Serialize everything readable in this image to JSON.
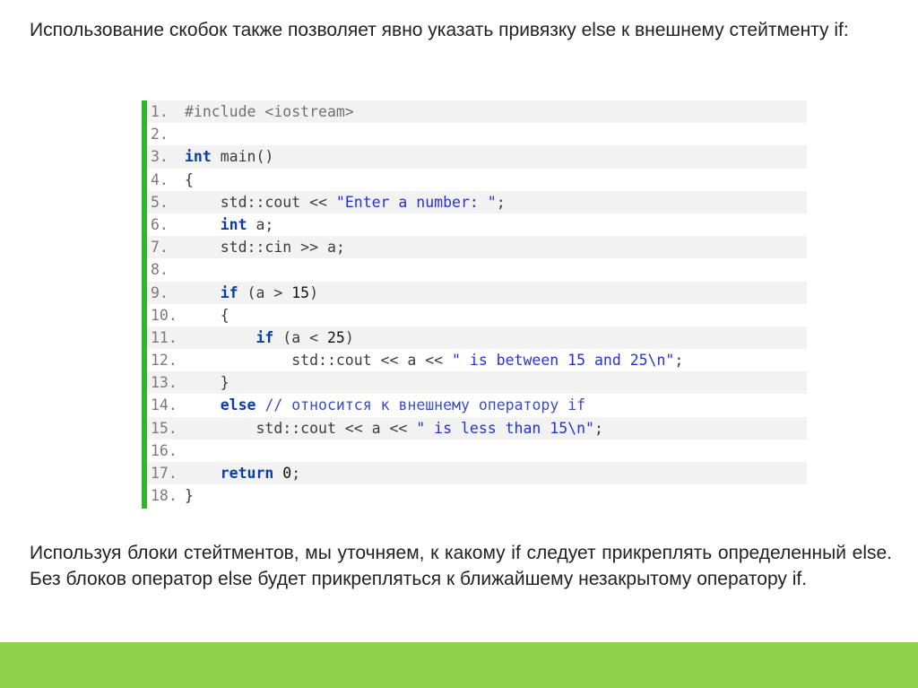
{
  "slide": {
    "intro_text": "Использование скобок также позволяет явно указать привязку else к внешнему стейтменту if:",
    "outro_text": "Используя блоки стейтментов, мы уточняем, к какому if следует прикреплять определенный else. Без блоков оператор else будет прикрепляться к ближайшему незакрытому оператору if."
  },
  "code": {
    "accent_color": "#2fb52f",
    "lines": [
      {
        "num": "1.",
        "parts": [
          {
            "t": "#include <iostream>",
            "c": "pp"
          }
        ]
      },
      {
        "num": "2.",
        "parts": []
      },
      {
        "num": "3.",
        "parts": [
          {
            "t": "int",
            "c": "kw"
          },
          {
            "t": " main()",
            "c": ""
          }
        ]
      },
      {
        "num": "4.",
        "parts": [
          {
            "t": "{",
            "c": ""
          }
        ]
      },
      {
        "num": "5.",
        "parts": [
          {
            "t": "    std::cout << ",
            "c": ""
          },
          {
            "t": "\"Enter a number: \"",
            "c": "str"
          },
          {
            "t": ";",
            "c": ""
          }
        ]
      },
      {
        "num": "6.",
        "parts": [
          {
            "t": "    ",
            "c": ""
          },
          {
            "t": "int",
            "c": "kw"
          },
          {
            "t": " a;",
            "c": ""
          }
        ]
      },
      {
        "num": "7.",
        "parts": [
          {
            "t": "    std::cin >> a;",
            "c": ""
          }
        ]
      },
      {
        "num": "8.",
        "parts": []
      },
      {
        "num": "9.",
        "parts": [
          {
            "t": "    ",
            "c": ""
          },
          {
            "t": "if",
            "c": "kw"
          },
          {
            "t": " (a > ",
            "c": ""
          },
          {
            "t": "15",
            "c": "num"
          },
          {
            "t": ")",
            "c": ""
          }
        ]
      },
      {
        "num": "10.",
        "parts": [
          {
            "t": "    {",
            "c": ""
          }
        ]
      },
      {
        "num": "11.",
        "parts": [
          {
            "t": "        ",
            "c": ""
          },
          {
            "t": "if",
            "c": "kw"
          },
          {
            "t": " (a < ",
            "c": ""
          },
          {
            "t": "25",
            "c": "num"
          },
          {
            "t": ")",
            "c": ""
          }
        ]
      },
      {
        "num": "12.",
        "parts": [
          {
            "t": "            std::cout << a << ",
            "c": ""
          },
          {
            "t": "\" is between 15 and 25\\n\"",
            "c": "str"
          },
          {
            "t": ";",
            "c": ""
          }
        ]
      },
      {
        "num": "13.",
        "parts": [
          {
            "t": "    }",
            "c": ""
          }
        ]
      },
      {
        "num": "14.",
        "parts": [
          {
            "t": "    ",
            "c": ""
          },
          {
            "t": "else",
            "c": "kw"
          },
          {
            "t": " ",
            "c": ""
          },
          {
            "t": "// относится к внешнему оператору if",
            "c": "cm"
          }
        ]
      },
      {
        "num": "15.",
        "parts": [
          {
            "t": "        std::cout << a << ",
            "c": ""
          },
          {
            "t": "\" is less than 15\\n\"",
            "c": "str"
          },
          {
            "t": ";",
            "c": ""
          }
        ]
      },
      {
        "num": "16.",
        "parts": []
      },
      {
        "num": "17.",
        "parts": [
          {
            "t": "    ",
            "c": ""
          },
          {
            "t": "return",
            "c": "kw"
          },
          {
            "t": " ",
            "c": ""
          },
          {
            "t": "0",
            "c": "num"
          },
          {
            "t": ";",
            "c": ""
          }
        ]
      },
      {
        "num": "18.",
        "parts": [
          {
            "t": "}",
            "c": ""
          }
        ]
      }
    ]
  },
  "footer": {
    "bar_color": "#8fd24a"
  }
}
